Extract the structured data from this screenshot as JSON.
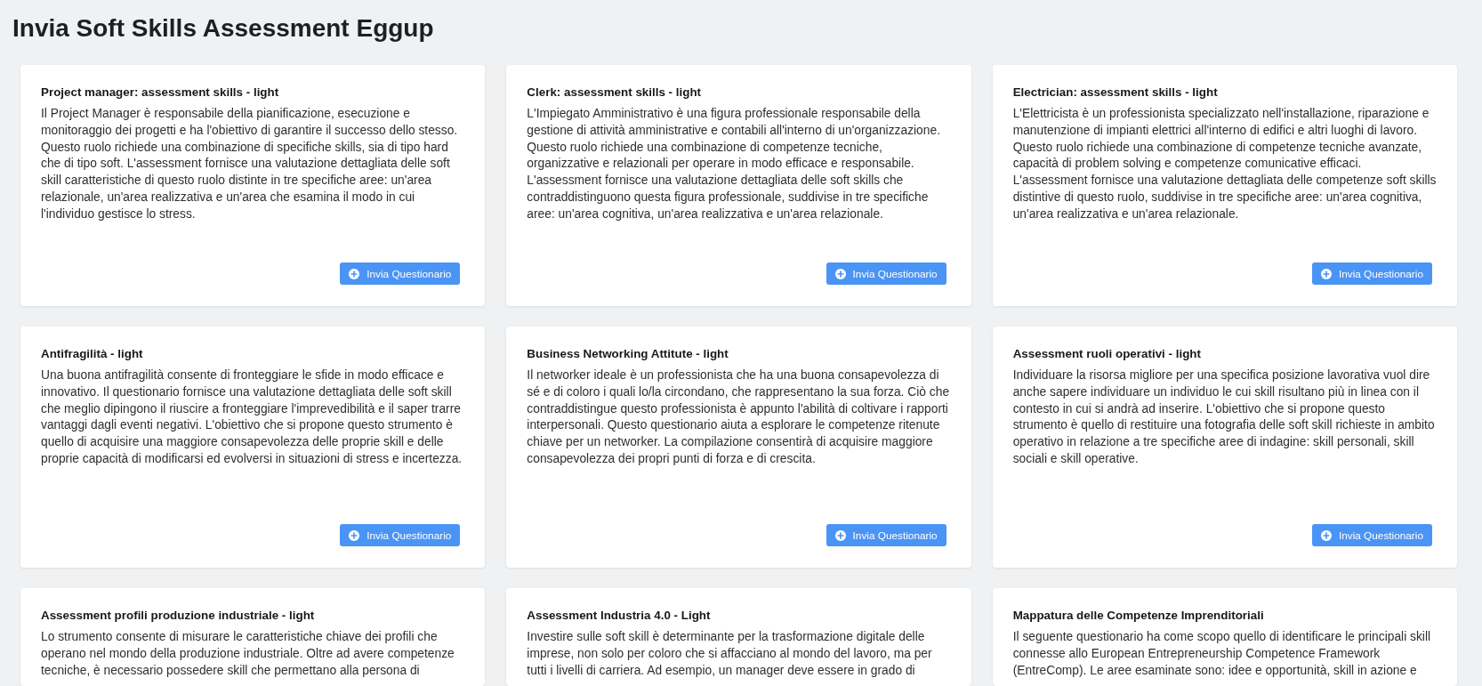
{
  "page": {
    "title": "Invia Soft Skills Assessment Eggup"
  },
  "cards": [
    {
      "title": "Project manager: assessment skills - light",
      "description": "Il Project Manager è responsabile della pianificazione, esecuzione e monitoraggio dei progetti e ha l'obiettivo di garantire il successo dello stesso. Questo ruolo richiede una combinazione di specifiche skills, sia di tipo hard che di tipo soft. L'assessment fornisce una valutazione dettagliata delle soft skill caratteristiche di questo ruolo distinte in tre specifiche aree: un'area relazionale, un'area realizzativa e un'area che esamina il modo in cui l'individuo gestisce lo stress.",
      "button": {
        "label": "Invia Questionario"
      }
    },
    {
      "title": "Clerk: assessment skills - light",
      "description": "L'Impiegato Amministrativo è una figura professionale responsabile della gestione di attività amministrative e contabili all'interno di un'organizzazione. Questo ruolo richiede una combinazione di competenze tecniche, organizzative e relazionali per operare in modo efficace e responsabile. L'assessment fornisce una valutazione dettagliata delle soft skills che contraddistinguono questa figura professionale, suddivise in tre specifiche aree: un'area cognitiva, un'area realizzativa e un'area relazionale.",
      "button": {
        "label": "Invia Questionario"
      }
    },
    {
      "title": "Electrician: assessment skills - light",
      "description": "L'Elettricista è un professionista specializzato nell'installazione, riparazione e manutenzione di impianti elettrici all'interno di edifici e altri luoghi di lavoro. Questo ruolo richiede una combinazione di competenze tecniche avanzate, capacità di problem solving e competenze comunicative efficaci. L'assessment fornisce una valutazione dettagliata delle competenze soft skills distintive di questo ruolo, suddivise in tre specifiche aree: un'area cognitiva, un'area realizzativa e un'area relazionale.",
      "button": {
        "label": "Invia Questionario"
      }
    },
    {
      "title": "Antifragilità - light",
      "description": "Una buona antifragilità consente di fronteggiare le sfide in modo efficace e innovativo. Il questionario fornisce una valutazione dettagliata delle soft skill che meglio dipingono il riuscire a fronteggiare l'imprevedibilità e il saper trarre vantaggi dagli eventi negativi. L'obiettivo che si propone questo strumento è quello di acquisire una maggiore consapevolezza delle proprie skill e delle proprie capacità di modificarsi ed evolversi in situazioni di stress e incertezza.",
      "button": {
        "label": "Invia Questionario"
      }
    },
    {
      "title": "Business Networking Attitute - light",
      "description": "Il networker ideale è un professionista che ha una buona consapevolezza di sé e di coloro i quali lo/la circondano, che rappresentano la sua forza. Ciò che contraddistingue questo professionista è appunto l'abilità di coltivare i rapporti interpersonali. Questo questionario aiuta a esplorare le competenze ritenute chiave per un networker. La compilazione consentirà di acquisire maggiore consapevolezza dei propri punti di forza e di crescita.",
      "button": {
        "label": "Invia Questionario"
      }
    },
    {
      "title": "Assessment ruoli operativi - light",
      "description": "Individuare la risorsa migliore per una specifica posizione lavorativa vuol dire anche sapere individuare un individuo le cui skill risultano più in linea con il contesto in cui si andrà ad inserire. L'obiettivo che si propone questo strumento è quello di restituire una fotografia delle soft skill richieste in ambito operativo in relazione a tre specifiche aree di indagine: skill personali, skill sociali e skill operative.",
      "button": {
        "label": "Invia Questionario"
      }
    },
    {
      "title": "Assessment profili produzione industriale - light",
      "description": "Lo strumento consente di misurare le caratteristiche chiave dei profili che operano nel mondo della produzione industriale. Oltre ad avere competenze tecniche, è necessario possedere skill che permettano alla persona di"
    },
    {
      "title": "Assessment Industria 4.0 - Light",
      "description": "Investire sulle soft skill è determinante per la trasformazione digitale delle imprese, non solo per coloro che si affacciano al mondo del lavoro, ma per tutti i livelli di carriera. Ad esempio, un manager deve essere in grado di"
    },
    {
      "title": "Mappatura delle Competenze Imprenditoriali",
      "description": "Il seguente questionario ha come scopo quello di identificare le principali skill connesse allo European Entrepreneurship Competence Framework (EntreComp). Le aree esaminate sono: idee e opportunità, skill in azione e"
    }
  ]
}
